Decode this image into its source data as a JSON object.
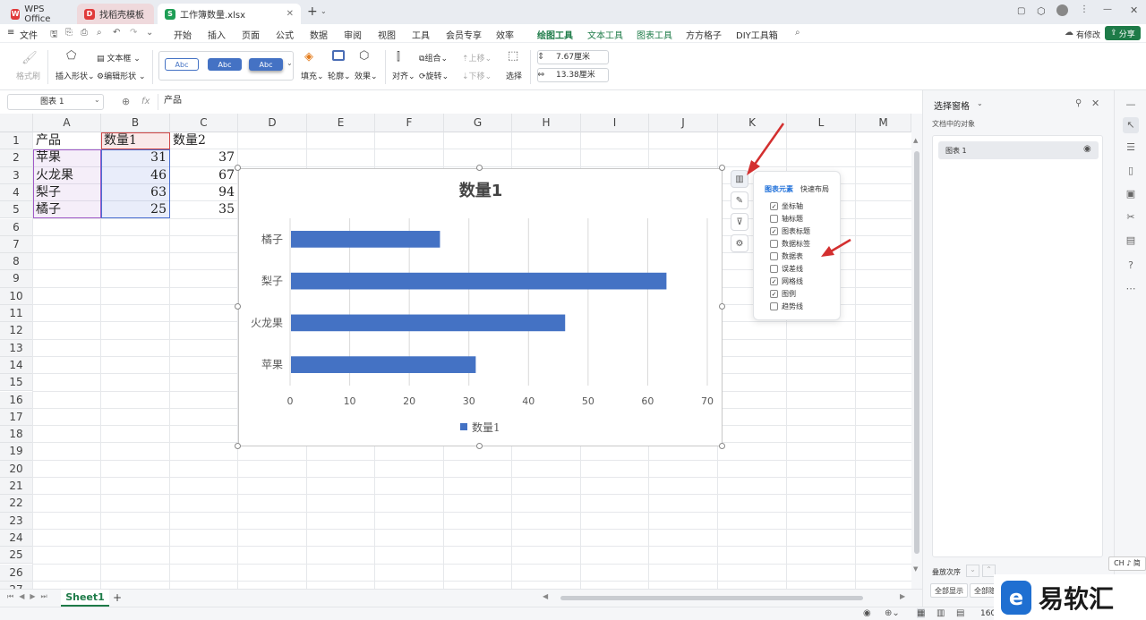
{
  "tabs": [
    {
      "label": "WPS Office"
    },
    {
      "label": "找稻壳模板"
    },
    {
      "label": "工作簿数量.xlsx"
    }
  ],
  "menu": {
    "file": "文件",
    "items": [
      "开始",
      "插入",
      "页面",
      "公式",
      "数据",
      "审阅",
      "视图",
      "工具",
      "会员专享",
      "效率"
    ],
    "ctx": [
      "绘图工具",
      "文本工具",
      "图表工具"
    ],
    "extra": [
      "方方格子",
      "DIY工具箱"
    ],
    "has_edit": "有修改",
    "share": "分享"
  },
  "ribbon": {
    "format_brush": "格式刷",
    "insert_shape": "插入形状",
    "textbox": "文本框",
    "edit_shape": "编辑形状",
    "style_label": "Abc",
    "fill": "填充",
    "outline": "轮廓",
    "effect": "效果",
    "align": "对齐",
    "group": "组合",
    "rotate": "旋转",
    "up": "上移",
    "down": "下移",
    "select": "选择",
    "height": "7.67厘米",
    "width": "13.38厘米"
  },
  "formula_bar": {
    "name_box": "图表 1",
    "fx": "fx",
    "content": "产品"
  },
  "grid": {
    "columns": [
      "A",
      "B",
      "C",
      "D",
      "E",
      "F",
      "G",
      "H",
      "I",
      "J",
      "K",
      "L",
      "M"
    ],
    "rows": [
      "1",
      "2",
      "3",
      "4",
      "5",
      "6",
      "7",
      "8",
      "9",
      "10",
      "11",
      "12",
      "13",
      "14",
      "15",
      "16",
      "17",
      "18",
      "19",
      "20",
      "21",
      "22",
      "23",
      "24",
      "25",
      "26",
      "27"
    ],
    "header": [
      "产品",
      "数量1",
      "数量2"
    ],
    "data": [
      [
        "苹果",
        "31",
        "37"
      ],
      [
        "火龙果",
        "46",
        "67"
      ],
      [
        "梨子",
        "63",
        "94"
      ],
      [
        "橘子",
        "25",
        "35"
      ]
    ]
  },
  "chart_data": {
    "type": "bar",
    "orientation": "horizontal",
    "title": "数量1",
    "categories": [
      "苹果",
      "火龙果",
      "梨子",
      "橘子"
    ],
    "series": [
      {
        "name": "数量1",
        "values": [
          31,
          46,
          63,
          25
        ]
      }
    ],
    "xlim": [
      0,
      70
    ],
    "ticks": [
      "0",
      "10",
      "20",
      "30",
      "40",
      "50",
      "60",
      "70"
    ],
    "grid": true,
    "legend": "bottom",
    "color": "#4472c4"
  },
  "chart_popup": {
    "tab_elements": "图表元素",
    "tab_layout": "快速布局",
    "items": [
      {
        "label": "坐标轴",
        "checked": true
      },
      {
        "label": "轴标题",
        "checked": false
      },
      {
        "label": "图表标题",
        "checked": true
      },
      {
        "label": "数据标签",
        "checked": false
      },
      {
        "label": "数据表",
        "checked": false
      },
      {
        "label": "误差线",
        "checked": false
      },
      {
        "label": "网格线",
        "checked": true
      },
      {
        "label": "图例",
        "checked": true
      },
      {
        "label": "趋势线",
        "checked": false
      }
    ]
  },
  "selection_pane": {
    "title": "选择窗格",
    "objects_label": "文档中的对象",
    "items": [
      "图表 1"
    ],
    "order_label": "叠放次序",
    "show_all": "全部显示",
    "hide_all": "全部隐"
  },
  "sheet_tabs": [
    "Sheet1"
  ],
  "status": {
    "zoom": "160",
    "ime": "CH ♪ 简"
  },
  "watermark": "易软汇",
  "colors": {
    "accent": "#1e7b48",
    "series": "#4472c4",
    "arrow": "#d32f2f"
  }
}
